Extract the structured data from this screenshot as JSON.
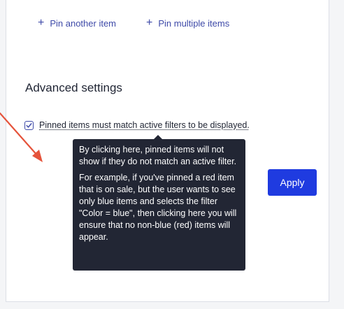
{
  "pin_actions": {
    "another_label": "Pin another item",
    "multiple_label": "Pin multiple items",
    "plus_glyph": "+"
  },
  "advanced": {
    "title": "Advanced settings",
    "checkbox_label": "Pinned items must match active filters to be displayed.",
    "checkbox_checked": true
  },
  "tooltip": {
    "paragraph1": "By clicking here, pinned items will not show if they do not match an active filter.",
    "paragraph2": "For example, if you've pinned a red item that is on sale, but the user wants to see only blue items and selects the filter \"Color = blue\", then clicking here you will ensure that no non-blue (red) items will appear."
  },
  "apply_label": "Apply",
  "colors": {
    "accent": "#1f3be0",
    "link": "#3e4aa8",
    "tooltip_bg": "#222634",
    "annotation_arrow": "#e5533b"
  },
  "icons": {
    "plus": "plus-icon",
    "check": "check-icon",
    "annotation": "annotation-arrow-icon"
  }
}
